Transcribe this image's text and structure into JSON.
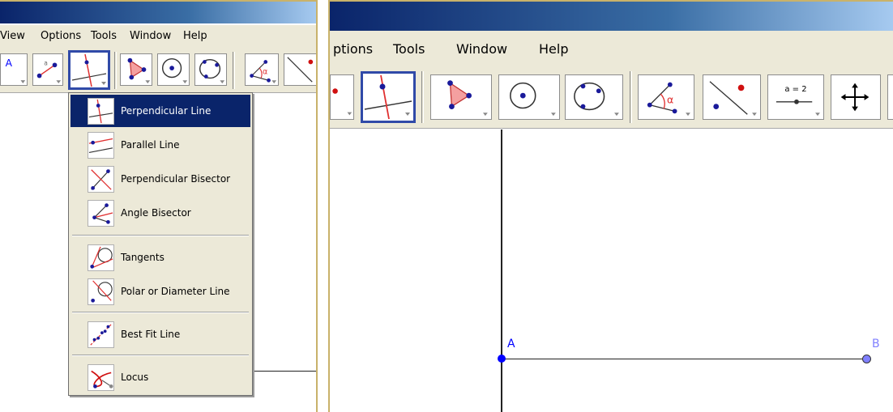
{
  "colors": {
    "accent": "#0a246a",
    "selected_border": "#304aa8",
    "point_A": "#0000ff",
    "point_B": "#8080ff"
  },
  "left": {
    "menu": [
      "View",
      "Options",
      "Tools",
      "Window",
      "Help"
    ],
    "toolbar_icons": [
      "point-icon",
      "segment-icon",
      "perpendicular-line-icon",
      "polygon-icon",
      "circle-with-center-icon",
      "circle-through-three-points-icon",
      "angle-icon",
      "reflect-icon"
    ],
    "dropdown": {
      "groups": [
        {
          "items": [
            {
              "label": "Perpendicular Line",
              "icon": "perpendicular-line-icon"
            },
            {
              "label": "Parallel Line",
              "icon": "parallel-line-icon"
            },
            {
              "label": "Perpendicular Bisector",
              "icon": "perpendicular-bisector-icon"
            },
            {
              "label": "Angle Bisector",
              "icon": "angle-bisector-icon"
            }
          ]
        },
        {
          "items": [
            {
              "label": "Tangents",
              "icon": "tangents-icon"
            },
            {
              "label": "Polar or Diameter Line",
              "icon": "polar-line-icon"
            }
          ]
        },
        {
          "items": [
            {
              "label": "Best Fit Line",
              "icon": "best-fit-line-icon"
            }
          ]
        },
        {
          "items": [
            {
              "label": "Locus",
              "icon": "locus-icon"
            }
          ]
        }
      ]
    }
  },
  "right": {
    "menu": [
      "ptions",
      "Tools",
      "Window",
      "Help"
    ],
    "toolbar_icons": [
      "point-icon",
      "perpendicular-line-icon",
      "polygon-icon",
      "circle-with-center-icon",
      "circle-through-three-points-icon",
      "angle-icon",
      "reflect-icon",
      "slider-icon",
      "move-view-icon"
    ],
    "slider_label": "a = 2",
    "points": {
      "a_label": "A",
      "b_label": "B"
    }
  }
}
